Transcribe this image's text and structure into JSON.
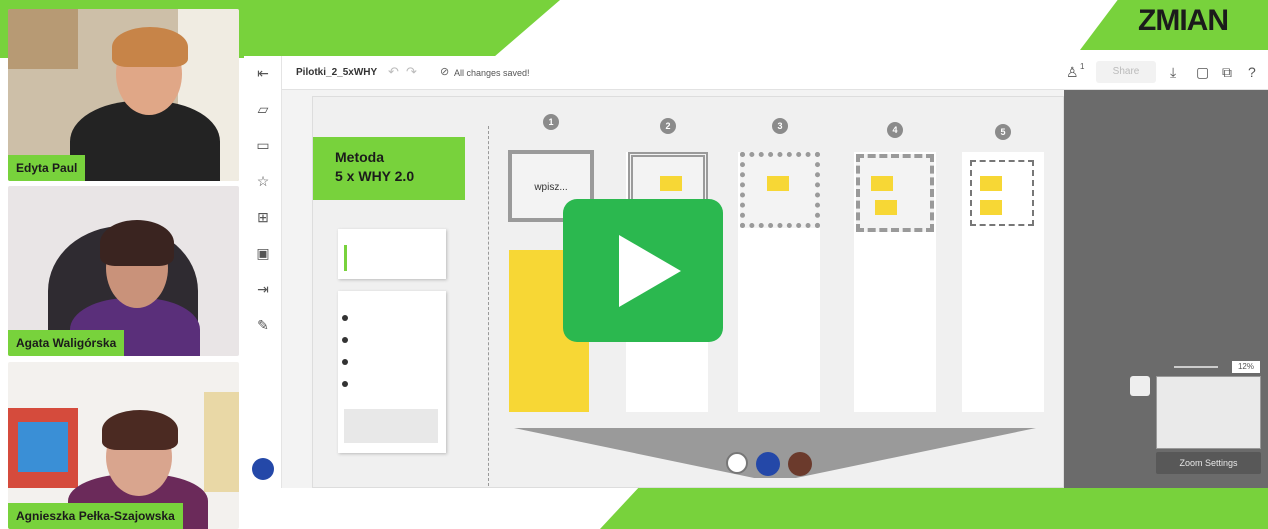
{
  "brand": {
    "logo_text": "ZMIAN",
    "accent": "#78d23c"
  },
  "participants": [
    {
      "name": "Edyta Paul"
    },
    {
      "name": "Agata Waligórska"
    },
    {
      "name": "Agnieszka Pełka-Szajowska"
    }
  ],
  "app": {
    "board_name": "Pilotki_2_5xWHY",
    "save_status": "All changes saved!",
    "share_label": "Share",
    "collaborator_count": "1",
    "zoom_settings_label": "Zoom Settings",
    "zoom_level": "12%",
    "toolbar_icons": [
      "exit-icon",
      "sticky-note-icon",
      "comment-icon",
      "star-icon",
      "grid-icon",
      "image-icon",
      "import-icon",
      "pen-icon"
    ]
  },
  "board": {
    "title_line1": "Metoda",
    "title_line2": "5 x WHY 2.0",
    "frame_numbers": [
      "1",
      "2",
      "3",
      "4",
      "5"
    ],
    "first_frame_text": "wpisz..."
  },
  "video": {
    "play_icon": "play-icon",
    "play_color": "#2bb84f"
  }
}
